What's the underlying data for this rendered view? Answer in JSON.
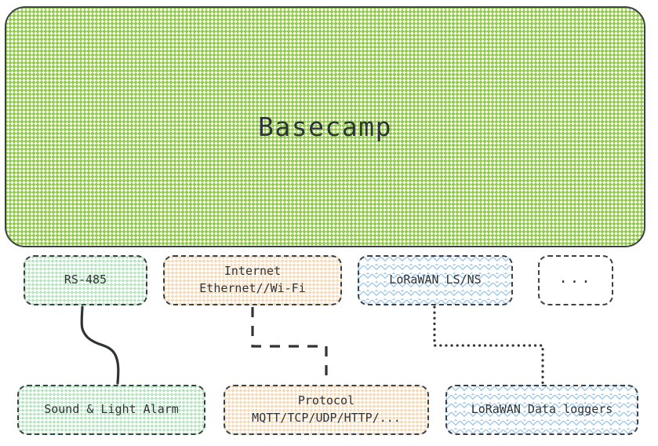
{
  "diagram": {
    "title": "Basecamp",
    "type": "architecture-block-diagram",
    "colors": {
      "stroke": "#3b4146",
      "text": "#2f3437",
      "basecamp_hatch": "#8cc740",
      "green_hatch": "#6cc97c",
      "orange_hatch": "#eeaa5c",
      "blue_hatch": "#6aaae2",
      "background": "#ffffff"
    },
    "basecamp": {
      "label": "Basecamp"
    },
    "transport_row": [
      {
        "id": "rs485",
        "label": "RS-485",
        "sublabel": "",
        "fill": "green",
        "border": "dashed"
      },
      {
        "id": "internet",
        "label": "Internet",
        "sublabel": "Ethernet//Wi-Fi",
        "fill": "orange",
        "border": "dashed"
      },
      {
        "id": "lorawan-ls-ns",
        "label": "LoRaWAN LS/NS",
        "sublabel": "",
        "fill": "blue",
        "border": "dashed"
      },
      {
        "id": "more",
        "label": "...",
        "sublabel": "",
        "fill": "none",
        "border": "dashed"
      }
    ],
    "device_row": [
      {
        "id": "sound-light-alarm",
        "label": "Sound & Light Alarm",
        "sublabel": "",
        "fill": "green",
        "border": "dashed"
      },
      {
        "id": "protocol",
        "label": "Protocol",
        "sublabel": "MQTT/TCP/UDP/HTTP/...",
        "fill": "orange",
        "border": "dashed"
      },
      {
        "id": "lorawan-data-loggers",
        "label": "LoRaWAN Data loggers",
        "sublabel": "",
        "fill": "blue",
        "border": "dashed"
      }
    ],
    "connectors": [
      {
        "id": "rs485-to-alarm",
        "from": "rs485",
        "to": "sound-light-alarm",
        "style": "solid-curve"
      },
      {
        "id": "internet-to-protocol",
        "from": "internet",
        "to": "protocol",
        "style": "dashed-step"
      },
      {
        "id": "lorawan-to-loggers",
        "from": "lorawan-ls-ns",
        "to": "lorawan-data-loggers",
        "style": "dotted-step"
      }
    ]
  }
}
